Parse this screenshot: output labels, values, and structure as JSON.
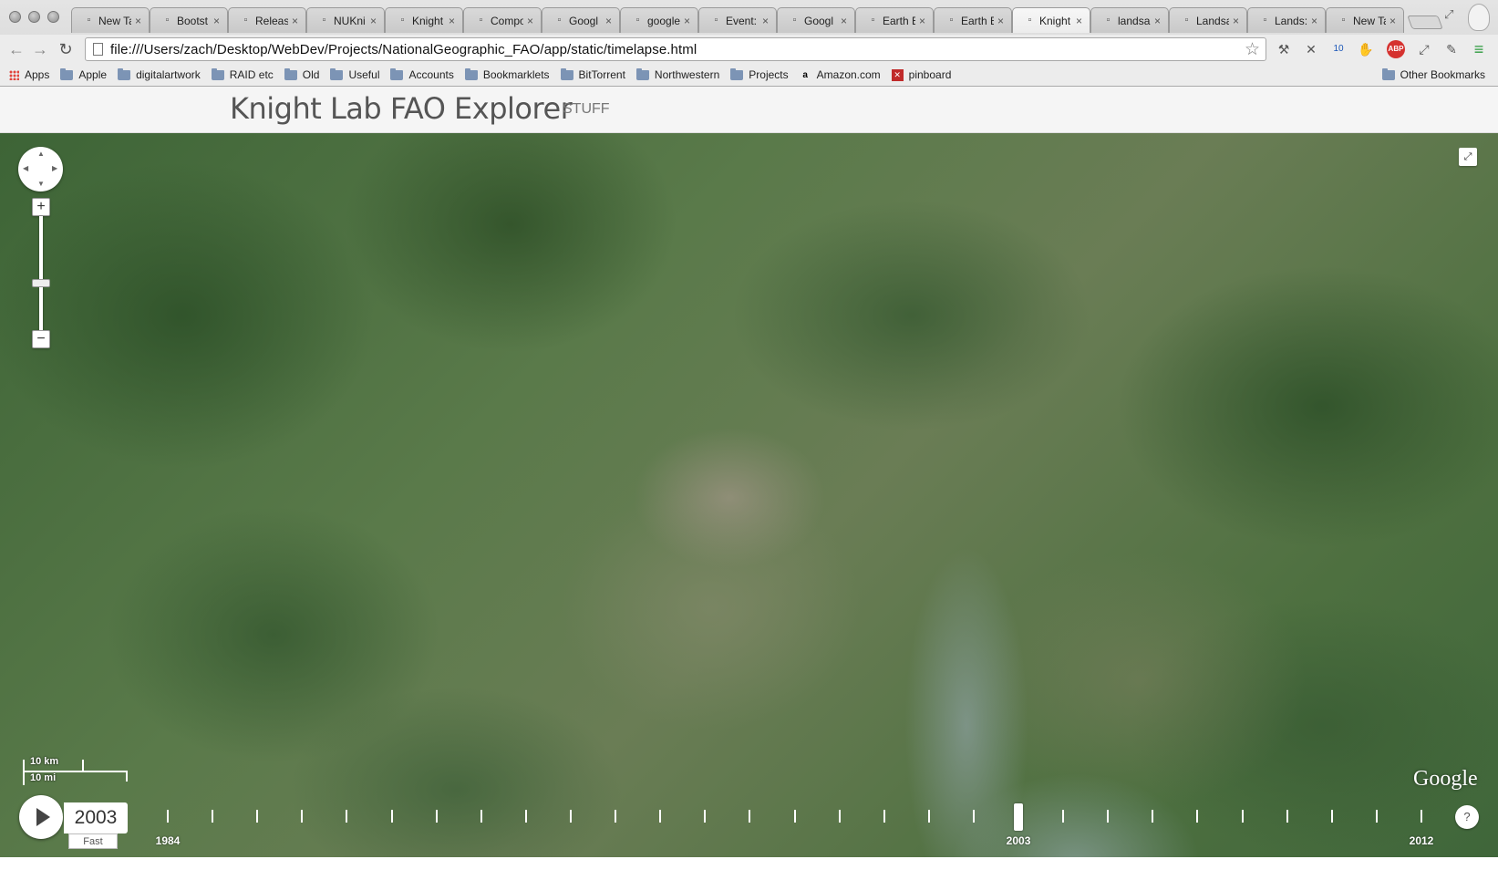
{
  "browser": {
    "tabs": [
      {
        "label": "New Tab",
        "icon": "blank-page-icon"
      },
      {
        "label": "Bootst",
        "icon": "page-icon"
      },
      {
        "label": "Releas",
        "icon": "github-icon"
      },
      {
        "label": "NUKni",
        "icon": "github-icon"
      },
      {
        "label": "Knight",
        "icon": "page-icon"
      },
      {
        "label": "Compo",
        "icon": "bootstrap-icon"
      },
      {
        "label": "Googl",
        "icon": "google-icon"
      },
      {
        "label": "google",
        "icon": "google-search-icon"
      },
      {
        "label": "Event:",
        "icon": "cloud-icon"
      },
      {
        "label": "Googl",
        "icon": "google-icon"
      },
      {
        "label": "Earth E",
        "icon": "app-icon"
      },
      {
        "label": "Earth E",
        "icon": "google-search-icon"
      },
      {
        "label": "Knight",
        "icon": "page-icon",
        "active": true
      },
      {
        "label": "landsa",
        "icon": "google-search-icon"
      },
      {
        "label": "Landsa",
        "icon": "landsat-icon"
      },
      {
        "label": "Lands:",
        "icon": "page-icon"
      },
      {
        "label": "New Tab",
        "icon": "blank-page-icon"
      }
    ],
    "tab_close_glyph": "×",
    "url": "file:///Users/zach/Desktop/WebDev/Projects/NationalGeographic_FAO/app/static/timelapse.html",
    "extension_badge": "10",
    "abp_label": "ABP",
    "bookmarks": [
      {
        "label": "Apps",
        "kind": "apps"
      },
      {
        "label": "Apple",
        "kind": "folder"
      },
      {
        "label": "digitalartwork",
        "kind": "folder"
      },
      {
        "label": "RAID etc",
        "kind": "folder"
      },
      {
        "label": "Old",
        "kind": "folder"
      },
      {
        "label": "Useful",
        "kind": "folder"
      },
      {
        "label": "Accounts",
        "kind": "folder"
      },
      {
        "label": "Bookmarklets",
        "kind": "folder"
      },
      {
        "label": "BitTorrent",
        "kind": "folder"
      },
      {
        "label": "Northwestern",
        "kind": "folder"
      },
      {
        "label": "Projects",
        "kind": "folder"
      },
      {
        "label": "Amazon.com",
        "kind": "amazon"
      },
      {
        "label": "pinboard",
        "kind": "pinboard"
      }
    ],
    "other_bookmarks": "Other Bookmarks"
  },
  "page": {
    "title": "Knight Lab FAO Explorer",
    "nav_item": "STUFF"
  },
  "map": {
    "scale_top": "10 km",
    "scale_bottom": "10 mi",
    "attribution": "Google",
    "zoom_in": "+",
    "zoom_out": "−",
    "zoom_level": 0.43,
    "fullscreen_glyph": "⤢"
  },
  "timelapse": {
    "current_year": "2003",
    "speed_label": "Fast",
    "start_year": 1984,
    "end_year": 2012,
    "tick_labels": [
      "1984",
      "2003",
      "2012"
    ],
    "help_label": "?"
  }
}
